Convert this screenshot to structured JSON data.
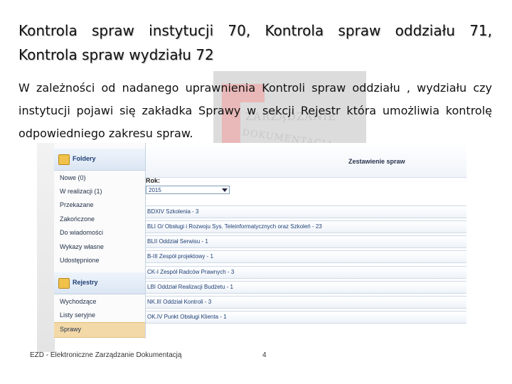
{
  "slide": {
    "title_line1": "Kontrola spraw instytucji 70, Kontrola spraw oddziału 71,",
    "title_line2": "Kontrola spraw wydziału 72",
    "body_line1": "W zależności od nadanego uprawnienia Kontroli spraw oddziału , wydziału czy",
    "body_line2": "instytucji pojawi się zakładka Sprawy w sekcji Rejestr która umożliwia kontrolę",
    "body_line3": "odpowiedniego zakresu spraw.",
    "footer": "EZD - Elektroniczne Zarządzanie Dokumentacją",
    "page_number": "4"
  },
  "watermark": {
    "line1": "ZARZĄDZANIE",
    "line2": "DOKUMENTACJĄ"
  },
  "app": {
    "folders_header": "Foldery",
    "folders": [
      "Nowe (0)",
      "W realizacji (1)",
      "Przekazane",
      "Zakończone",
      "Do wiadomości",
      "Wykazy własne",
      "Udostępnione"
    ],
    "registers_header": "Rejestry",
    "registers": [
      "Wychodzące",
      "Listy seryjne",
      "Sprawy"
    ],
    "selected_item": "Sprawy",
    "panel_title": "Zestawienie spraw",
    "year_label": "Rok:",
    "year_value": "2015",
    "rows": [
      "BDXIV Szkolenia - 3",
      "BLI O/ Obsługi i Rozwoju Sys. Teleinformatycznych oraz Szkoleń - 23",
      "BLII Oddział Serwisu - 1",
      "B-III Zespół projektowy - 1",
      "CK-I Zespół Radców Prawnych - 3",
      "LBI Oddział Realizacji Budżetu - 1",
      "NK.III Oddział Kontroli - 3",
      "OK.IV Punkt Obsługi Klienta - 1"
    ]
  },
  "colors": {
    "selected_bg": "#f4d9a8",
    "link_text": "#1f3f75",
    "folder_icon": "#f0c24a"
  }
}
